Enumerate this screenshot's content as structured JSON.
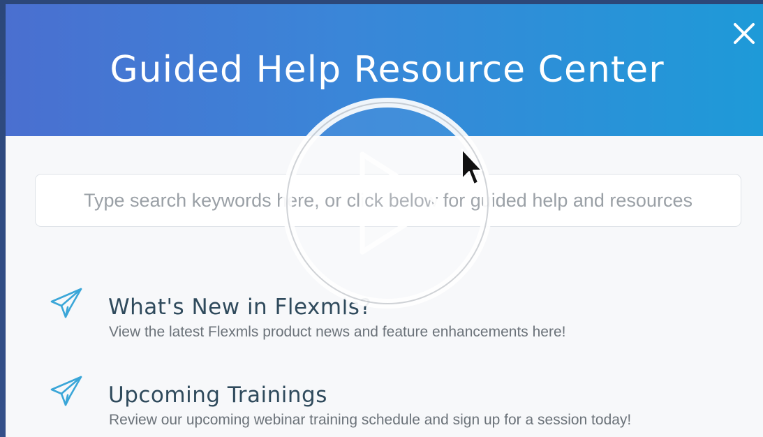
{
  "dialog": {
    "title": "Guided Help Resource Center",
    "close_icon": "close-icon"
  },
  "search": {
    "placeholder": "Type search keywords here, or click below for guided help and resources",
    "value": ""
  },
  "resources": [
    {
      "icon": "paper-plane-icon",
      "title": "What's New in Flexmls?",
      "description": "View the latest Flexmls product news and feature enhancements here!"
    },
    {
      "icon": "paper-plane-icon",
      "title": "Upcoming Trainings",
      "description": "Review our upcoming webinar training schedule and sign up for a session today!"
    }
  ],
  "video_overlay": {
    "icon": "play-icon"
  },
  "colors": {
    "header_start": "#4a6fd0",
    "header_end": "#1e9ad8",
    "accent_icon": "#3aa6d8",
    "title_text": "#2f4a5c"
  }
}
